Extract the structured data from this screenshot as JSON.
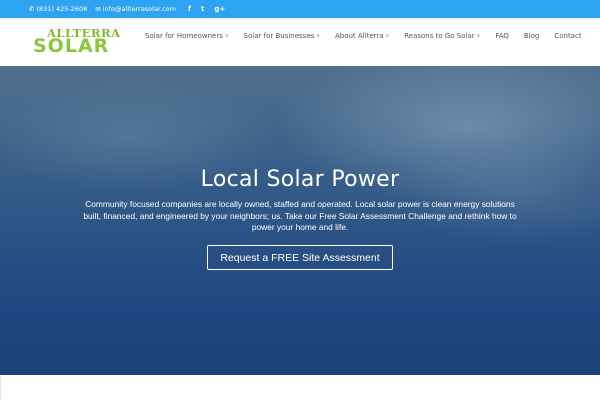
{
  "topbar": {
    "phone": "(831) 425-2608",
    "email": "info@allterrasolar.com",
    "social": [
      "f",
      "t",
      "g+"
    ],
    "phone_icon": "phone-icon",
    "email_icon": "envelope-icon"
  },
  "logo": {
    "line1": "ALLTERRA",
    "line2": "SOLAR",
    "colors": {
      "line1": "#84b82c",
      "line2": "#8cc63f"
    }
  },
  "nav": {
    "items": [
      {
        "label": "Solar for Homeowners",
        "dropdown": true
      },
      {
        "label": "Solar for Businesses",
        "dropdown": true
      },
      {
        "label": "About Allterra",
        "dropdown": true
      },
      {
        "label": "Reasons to Go Solar",
        "dropdown": true
      },
      {
        "label": "FAQ",
        "dropdown": false
      },
      {
        "label": "Blog",
        "dropdown": false
      },
      {
        "label": "Contact",
        "dropdown": false
      }
    ],
    "caret": "∨"
  },
  "hero": {
    "title": "Local Solar Power",
    "text": "Community focused companies are locally owned, staffed and operated. Local solar power is clean energy solutions built, financed, and engineered by your neighbors; us. Take our Free Solar Assessment Challenge and rethink how to power your home and life.",
    "cta_label": "Request a FREE Site Assessment"
  },
  "colors": {
    "topbar": "#2ea3f2",
    "hero_dark": "#1b4179"
  }
}
